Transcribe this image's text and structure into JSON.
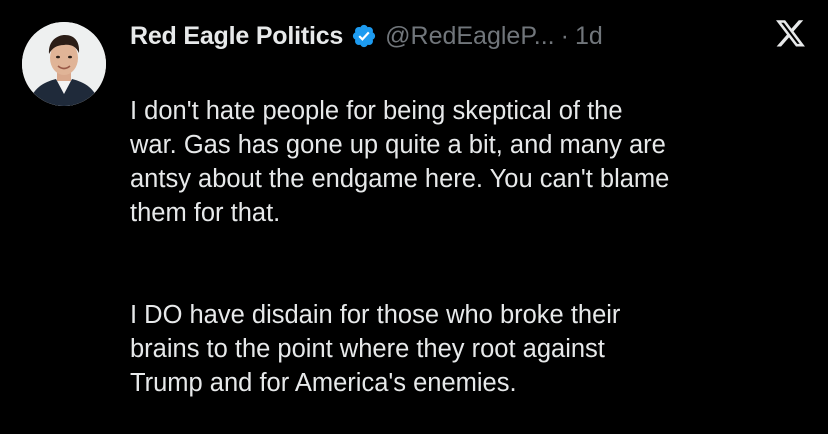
{
  "tweet": {
    "display_name": "Red Eagle Politics",
    "handle": "@RedEagleP...",
    "separator": "·",
    "time": "1d",
    "paragraphs": [
      "I don't hate people for being skeptical of the\nwar. Gas has gone up quite a bit, and many are\nantsy about the endgame here. You can't blame\nthem for that.",
      "I DO have disdain for those who broke their\nbrains to the point where they root against\nTrump and for America's enemies."
    ]
  },
  "icons": {
    "verified": "verified-badge-icon",
    "brand": "x-logo-icon"
  },
  "colors": {
    "background": "#000000",
    "text_primary": "#e7e9ea",
    "text_secondary": "#71767b",
    "verified": "#1d9bf0"
  }
}
